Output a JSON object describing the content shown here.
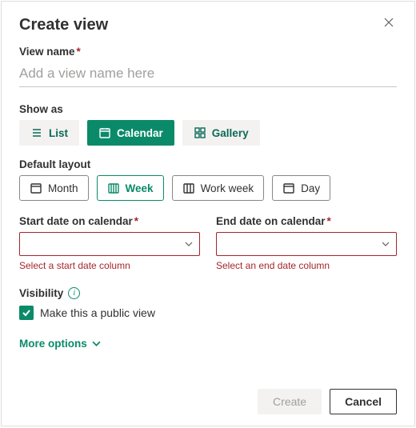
{
  "dialog": {
    "title": "Create view",
    "close_tooltip": "Close"
  },
  "view_name": {
    "label": "View name",
    "required_mark": "*",
    "placeholder": "Add a view name here",
    "value": ""
  },
  "show_as": {
    "label": "Show as",
    "options": [
      "List",
      "Calendar",
      "Gallery"
    ],
    "selected": "Calendar"
  },
  "default_layout": {
    "label": "Default layout",
    "options": [
      "Month",
      "Week",
      "Work week",
      "Day"
    ],
    "selected": "Week"
  },
  "start_date": {
    "label": "Start date on calendar",
    "required_mark": "*",
    "value": "",
    "error": "Select a start date column"
  },
  "end_date": {
    "label": "End date on calendar",
    "required_mark": "*",
    "value": "",
    "error": "Select an end date column"
  },
  "visibility": {
    "label": "Visibility",
    "checkbox_label": "Make this a public view",
    "checked": true
  },
  "more_options_label": "More options",
  "buttons": {
    "create": "Create",
    "cancel": "Cancel"
  }
}
